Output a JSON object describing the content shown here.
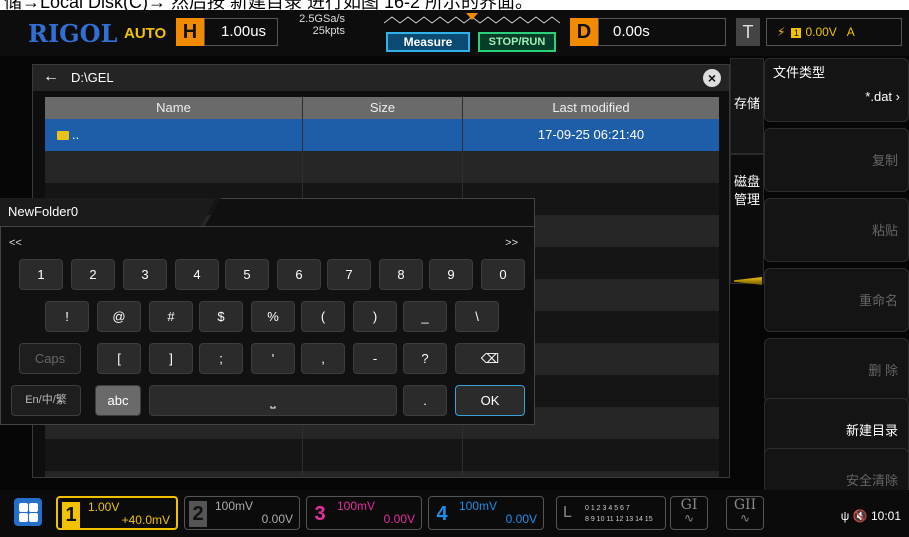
{
  "caption": {
    "text": "储→Local Disk(C)→ 然后按 新建目录 进行如图 16-2 所示的界面。"
  },
  "topbar": {
    "logo": "RIGOL",
    "mode": "AUTO",
    "timebase_label": "H",
    "timebase_value": "1.00us",
    "sample_rate": "2.5GSa/s",
    "memory_depth": "25kpts",
    "measure_label": "Measure",
    "stop_run_label": "STOP/RUN",
    "delay_label": "D",
    "delay_value": "0.00s",
    "trigger_label": "T",
    "trigger_channel": "1",
    "trigger_level": "0.00V",
    "trigger_mode": "A"
  },
  "dialog": {
    "path": "D:\\GEL",
    "columns": [
      "Name",
      "Size",
      "Last modified"
    ],
    "rows": [
      {
        "name": "..",
        "size": "",
        "modified": "17-09-25 06:21:40",
        "selected": true
      }
    ]
  },
  "menu": {
    "side_tab_1": "存储",
    "side_tab_2": "磁盘管理",
    "file_type_label": "文件类型",
    "file_type_value": "*.dat",
    "copy": "复制",
    "paste": "粘贴",
    "rename": "重命名",
    "delete": "删 除",
    "new_dir": "新建目录",
    "secure_erase": "安全清除"
  },
  "keyboard": {
    "input_value": "NewFolder0",
    "nav_left": "<<",
    "nav_right": ">>",
    "row1": [
      "1",
      "2",
      "3",
      "4",
      "5",
      "6",
      "7",
      "8",
      "9",
      "0"
    ],
    "row2": [
      "!",
      "@",
      "#",
      "$",
      "%",
      "(",
      ")",
      "_",
      "\\"
    ],
    "row3": [
      "Caps",
      "[",
      "]",
      ";",
      "'",
      ",",
      "-",
      "?"
    ],
    "lang": "En/中/繁",
    "abc": "abc",
    "dot": ".",
    "ok": "OK"
  },
  "bottombar": {
    "ch1_num": "1",
    "ch1_scale": "1.00V",
    "ch1_offset": "+40.0mV",
    "ch2_num": "2",
    "ch2_scale": "100mV",
    "ch2_offset": "0.00V",
    "ch3_num": "3",
    "ch3_scale": "100mV",
    "ch3_offset": "0.00V",
    "ch4_num": "4",
    "ch4_scale": "100mV",
    "ch4_offset": "0.00V",
    "la_label": "L",
    "la_line1": "0 1 2 3  4 5 6 7",
    "la_line2": "8 9 10 11 12 13 14 15",
    "g1": "GI",
    "g2": "GII",
    "time": "10:01"
  },
  "colors": {
    "ch1": "#f2c200",
    "ch2": "#9a9a9a",
    "ch3": "#e62e9f",
    "ch4": "#1e8fe8",
    "accent": "#f18a00"
  }
}
